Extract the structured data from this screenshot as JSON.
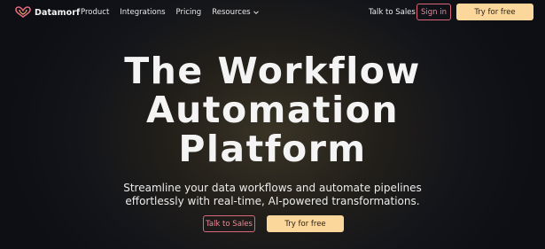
{
  "brand": {
    "name": "Datamorf",
    "logo_icon": "datamorf-logo-icon"
  },
  "nav": {
    "links": [
      {
        "label": "Product"
      },
      {
        "label": "Integrations"
      },
      {
        "label": "Pricing"
      },
      {
        "label": "Resources",
        "icon": "chevron-down-icon"
      }
    ],
    "talk_to_sales": "Talk to Sales",
    "sign_in": "Sign in",
    "try_for_free": "Try for free"
  },
  "hero": {
    "title_lines": [
      "The Workflow",
      "Automation",
      "Platform"
    ],
    "subtitle_lines": [
      "Streamline your data workflows and automate pipelines",
      "effortlessly with real-time, AI-powered transformations."
    ],
    "cta_secondary": "Talk to Sales",
    "cta_primary": "Try for free"
  },
  "colors": {
    "accent_outline": "#d9667a",
    "primary_button": "#fcd79c",
    "background": "#0d0f14"
  }
}
